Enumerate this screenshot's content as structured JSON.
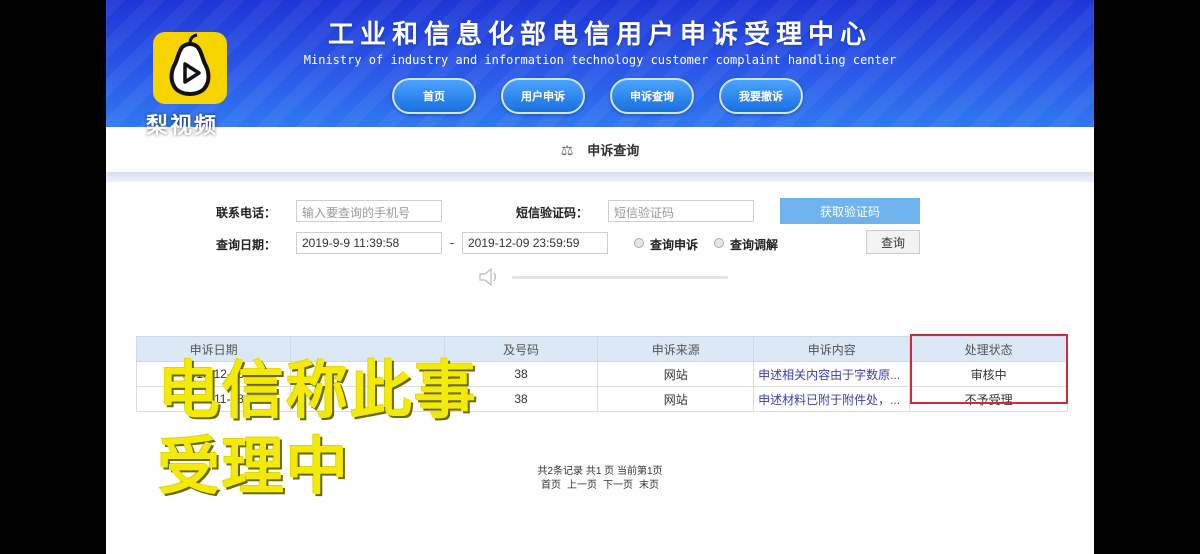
{
  "header": {
    "title_cn": "工业和信息化部电信用户申诉受理中心",
    "title_en": "Ministry of industry and information technology customer complaint handling center",
    "nav": [
      "首页",
      "用户申诉",
      "申诉查询",
      "我要撤诉"
    ]
  },
  "logo": {
    "text": "梨视频",
    "color": "#f6d400"
  },
  "section": {
    "title": "申诉查询"
  },
  "form": {
    "phone_label": "联系电话：",
    "phone_placeholder": "输入要查询的手机号",
    "sms_label": "短信验证码：",
    "sms_placeholder": "短信验证码",
    "get_code_button": "获取验证码",
    "date_label": "查询日期：",
    "date_start": "2019-9-9 11:39:58",
    "date_separator": "-",
    "date_end": "2019-12-09 23:59:59",
    "radio_complaint": "查询申诉",
    "radio_mediation": "查询调解",
    "query_button": "查询"
  },
  "table": {
    "headers": [
      "申诉日期",
      "",
      "及号码",
      "申诉来源",
      "申诉内容",
      "处理状态"
    ],
    "rows": [
      {
        "date": "2019-12-06",
        "col2": "",
        "number": "38",
        "source": "网站",
        "content": "申述相关内容由于字数原...",
        "status": "审核中"
      },
      {
        "date": "2019-11-28",
        "col2": "",
        "number": "38",
        "source": "网站",
        "content": "申述材料已附于附件处，...",
        "status": "不予受理"
      }
    ]
  },
  "pager": {
    "summary": "共2条记录 共1 页 当前第1页",
    "first": "首页",
    "prev": "上一页",
    "next": "下一页",
    "last": "末页"
  },
  "caption": {
    "line1": "电信称此事",
    "line2": "受理中",
    "color": "#f3ea0a"
  },
  "colors": {
    "banner": "#2a57e8",
    "highlight_box": "#d12a3c",
    "code_button": "#6fb3ee"
  }
}
